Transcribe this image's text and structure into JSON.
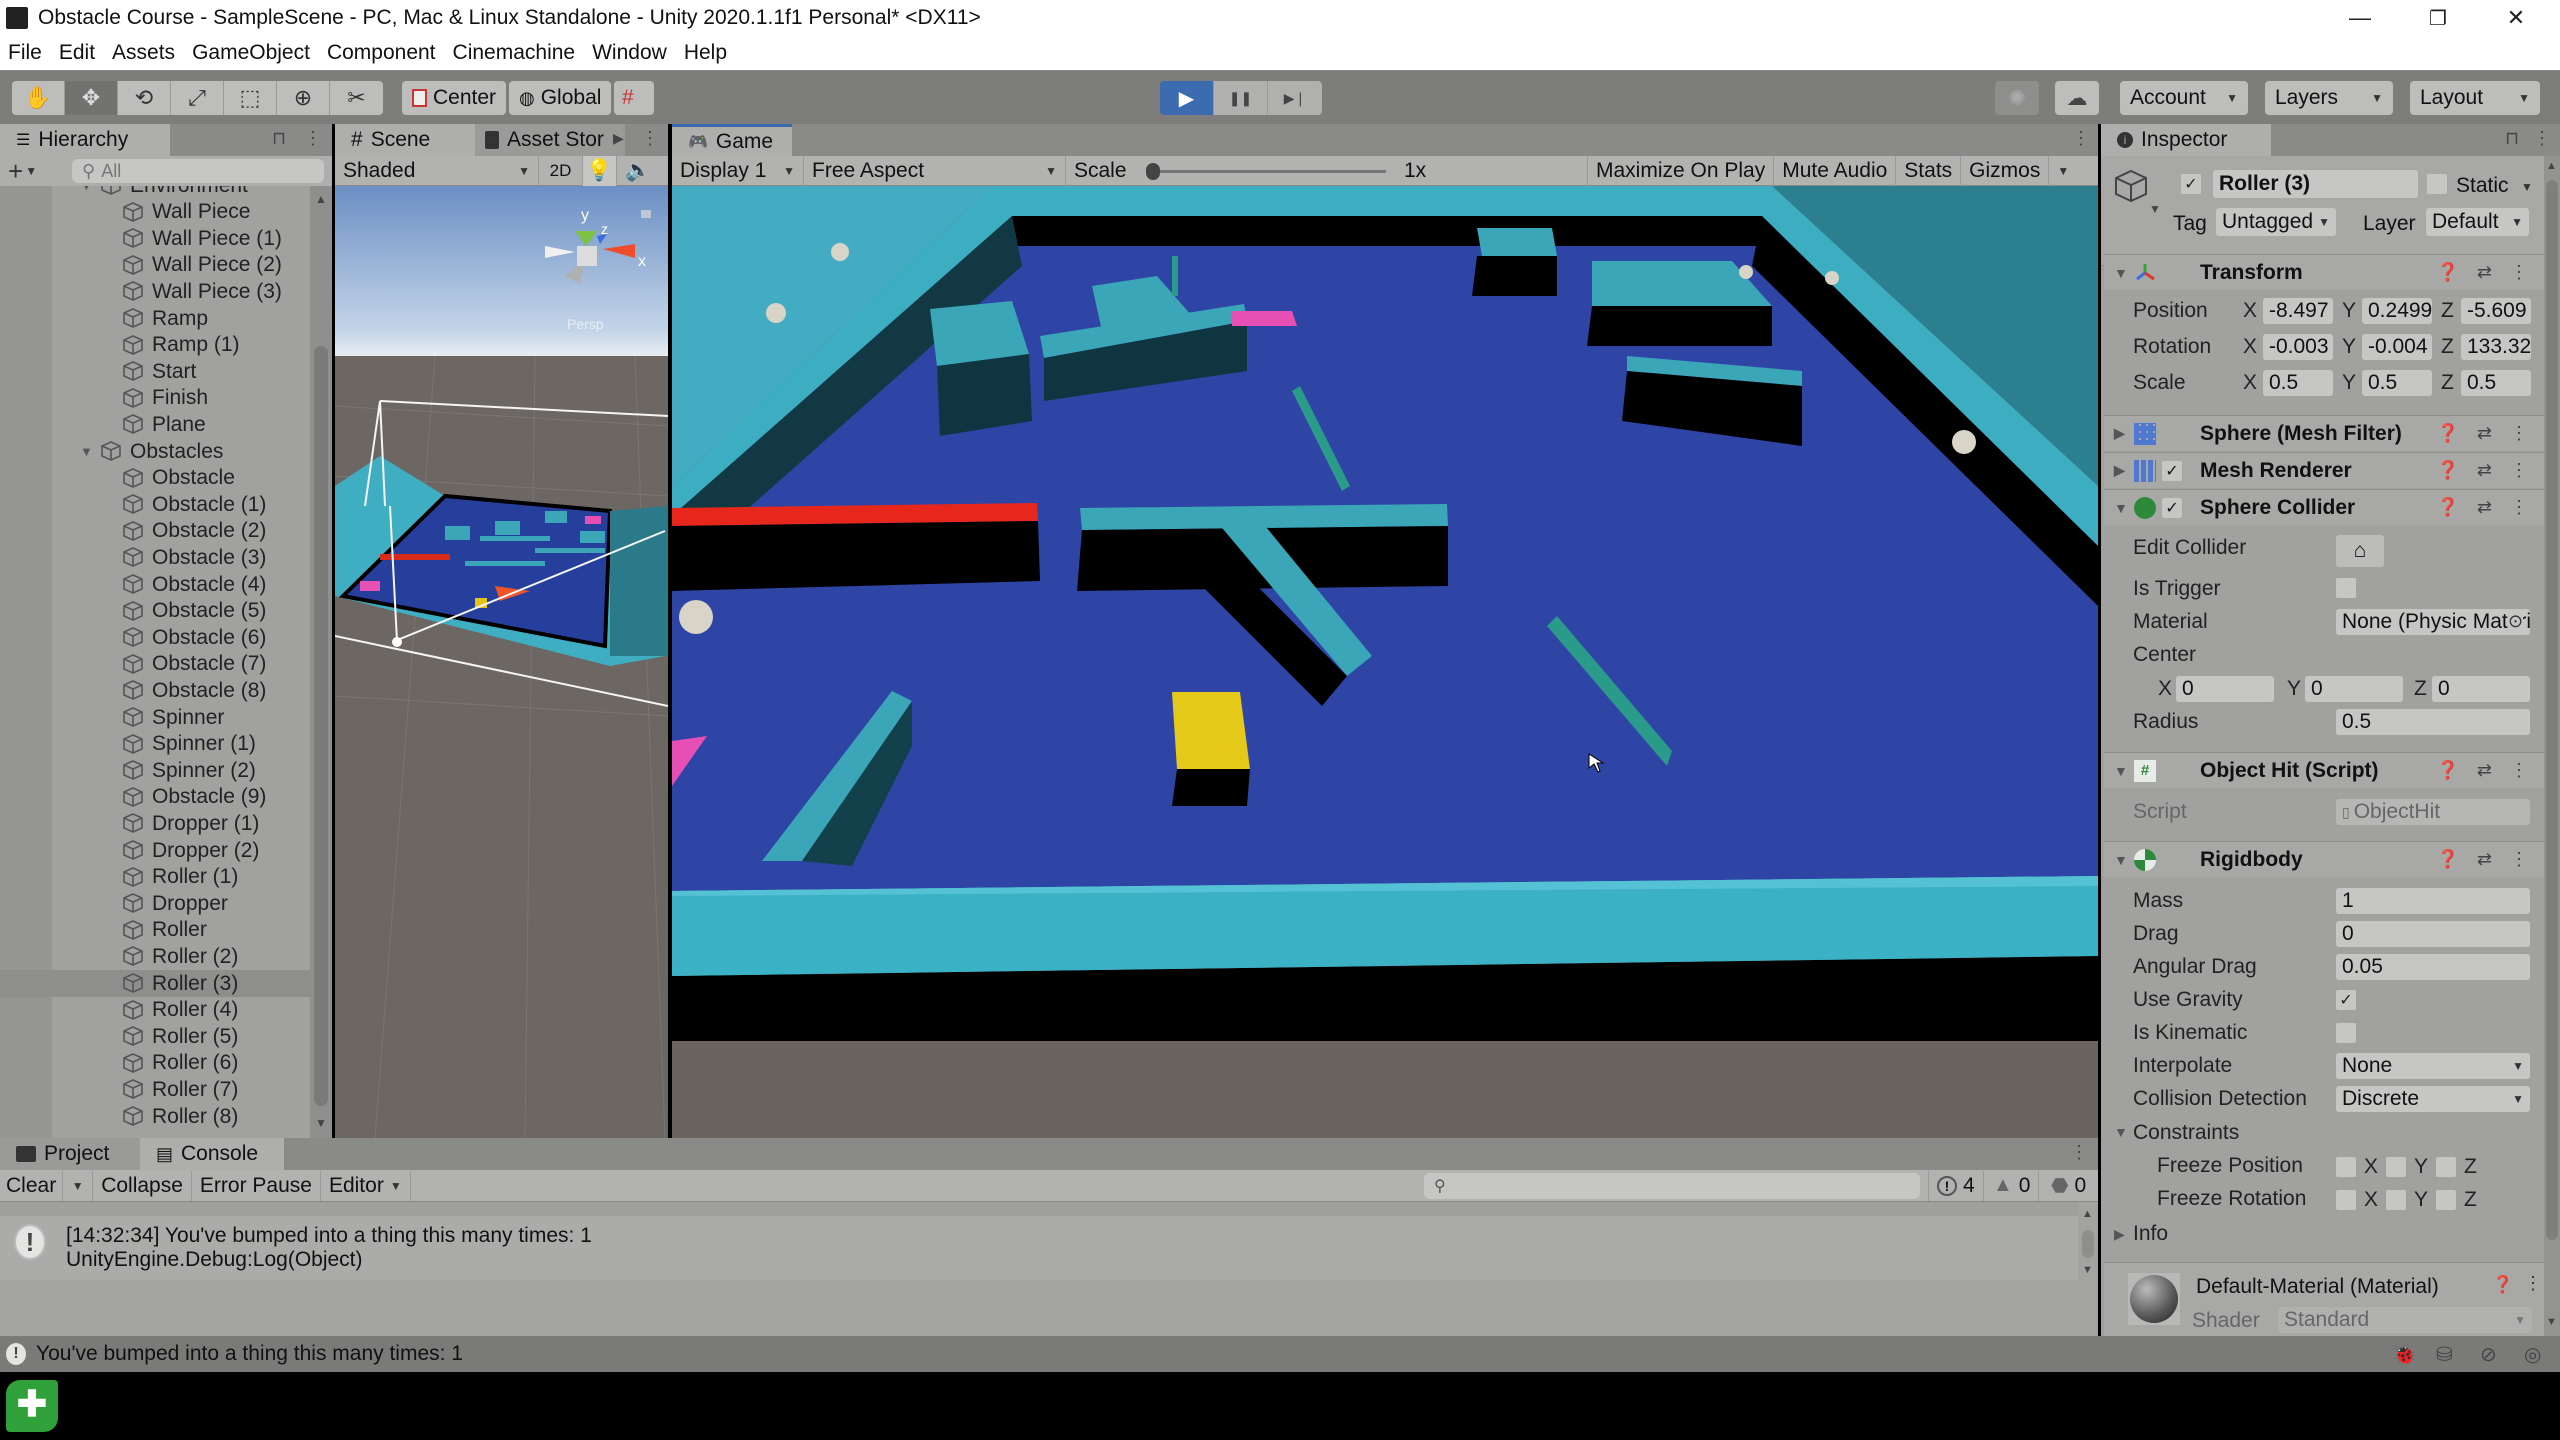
{
  "window": {
    "title": "Obstacle Course - SampleScene - PC, Mac & Linux Standalone - Unity 2020.1.1f1 Personal* <DX11>",
    "minimize": "—",
    "restore": "❐",
    "close": "✕"
  },
  "menu": [
    "File",
    "Edit",
    "Assets",
    "GameObject",
    "Component",
    "Cinemachine",
    "Window",
    "Help"
  ],
  "toolbar": {
    "tools": [
      "hand-tool",
      "move-tool",
      "rotate-tool",
      "scale-tool",
      "rect-tool",
      "transform-tool",
      "custom-tool"
    ],
    "tool_glyphs": [
      "✋",
      "✥",
      "⟲",
      "⤢",
      "⬚",
      "⊕",
      "✂"
    ],
    "pivot_label": "Center",
    "space_label": "Global",
    "play_glyph": "▶",
    "pause_glyph": "❚❚",
    "step_glyph": "▶❘",
    "account_label": "Account",
    "layers_label": "Layers",
    "layout_label": "Layout"
  },
  "hierarchy": {
    "tab_label": "Hierarchy",
    "search_placeholder": "All",
    "items": [
      {
        "label": "Environment",
        "depth": 1,
        "expanded": true
      },
      {
        "label": "Wall Piece",
        "depth": 2
      },
      {
        "label": "Wall Piece (1)",
        "depth": 2
      },
      {
        "label": "Wall Piece (2)",
        "depth": 2
      },
      {
        "label": "Wall Piece (3)",
        "depth": 2
      },
      {
        "label": "Ramp",
        "depth": 2
      },
      {
        "label": "Ramp (1)",
        "depth": 2
      },
      {
        "label": "Start",
        "depth": 2
      },
      {
        "label": "Finish",
        "depth": 2
      },
      {
        "label": "Plane",
        "depth": 2
      },
      {
        "label": "Obstacles",
        "depth": 1,
        "expanded": true
      },
      {
        "label": "Obstacle",
        "depth": 2
      },
      {
        "label": "Obstacle (1)",
        "depth": 2
      },
      {
        "label": "Obstacle (2)",
        "depth": 2
      },
      {
        "label": "Obstacle (3)",
        "depth": 2
      },
      {
        "label": "Obstacle (4)",
        "depth": 2
      },
      {
        "label": "Obstacle (5)",
        "depth": 2
      },
      {
        "label": "Obstacle (6)",
        "depth": 2
      },
      {
        "label": "Obstacle (7)",
        "depth": 2
      },
      {
        "label": "Obstacle (8)",
        "depth": 2
      },
      {
        "label": "Spinner",
        "depth": 2
      },
      {
        "label": "Spinner (1)",
        "depth": 2
      },
      {
        "label": "Spinner (2)",
        "depth": 2
      },
      {
        "label": "Obstacle (9)",
        "depth": 2
      },
      {
        "label": "Dropper (1)",
        "depth": 2
      },
      {
        "label": "Dropper (2)",
        "depth": 2
      },
      {
        "label": "Roller (1)",
        "depth": 2
      },
      {
        "label": "Dropper",
        "depth": 2
      },
      {
        "label": "Roller",
        "depth": 2
      },
      {
        "label": "Roller (2)",
        "depth": 2
      },
      {
        "label": "Roller (3)",
        "depth": 2,
        "selected": true
      },
      {
        "label": "Roller (4)",
        "depth": 2
      },
      {
        "label": "Roller (5)",
        "depth": 2
      },
      {
        "label": "Roller (6)",
        "depth": 2
      },
      {
        "label": "Roller (7)",
        "depth": 2
      },
      {
        "label": "Roller (8)",
        "depth": 2
      }
    ]
  },
  "scene": {
    "tab_label": "Scene",
    "asset_store_tab": "Asset Stor",
    "shading_mode": "Shaded",
    "mode_2d": "2D",
    "gizmo_axes": {
      "x": "x",
      "y": "y",
      "z": "z"
    },
    "projection_label": "Persp"
  },
  "game": {
    "tab_label": "Game",
    "display": "Display 1",
    "aspect": "Free Aspect",
    "scale_label": "Scale",
    "scale_value": "1x",
    "scale_fraction": 0.0,
    "maximize_on_play": "Maximize On Play",
    "mute_audio": "Mute Audio",
    "stats": "Stats",
    "gizmos": "Gizmos"
  },
  "inspector": {
    "tab_label": "Inspector",
    "object_name": "Roller (3)",
    "active": true,
    "static_label": "Static",
    "static": false,
    "tag_label": "Tag",
    "tag": "Untagged",
    "layer_label": "Layer",
    "layer": "Default",
    "transform": {
      "title": "Transform",
      "position": {
        "label": "Position",
        "x": "-8.497",
        "y": "0.2499",
        "z": "-5.609"
      },
      "rotation": {
        "label": "Rotation",
        "x": "-0.003",
        "y": "-0.004",
        "z": "133.32"
      },
      "scale": {
        "label": "Scale",
        "x": "0.5",
        "y": "0.5",
        "z": "0.5"
      }
    },
    "mesh_filter": {
      "title": "Sphere (Mesh Filter)"
    },
    "mesh_renderer": {
      "title": "Mesh Renderer",
      "enabled": true
    },
    "sphere_collider": {
      "title": "Sphere Collider",
      "enabled": true,
      "edit_collider_label": "Edit Collider",
      "is_trigger_label": "Is Trigger",
      "is_trigger": false,
      "material_label": "Material",
      "material": "None (Physic Material)",
      "center_label": "Center",
      "center": {
        "x": "0",
        "y": "0",
        "z": "0"
      },
      "radius_label": "Radius",
      "radius": "0.5"
    },
    "object_hit": {
      "title": "Object Hit (Script)",
      "script_label": "Script",
      "script": "ObjectHit"
    },
    "rigidbody": {
      "title": "Rigidbody",
      "mass_label": "Mass",
      "mass": "1",
      "drag_label": "Drag",
      "drag": "0",
      "angular_drag_label": "Angular Drag",
      "angular_drag": "0.05",
      "use_gravity_label": "Use Gravity",
      "use_gravity": true,
      "is_kinematic_label": "Is Kinematic",
      "is_kinematic": false,
      "interpolate_label": "Interpolate",
      "interpolate": "None",
      "collision_label": "Collision Detection",
      "collision": "Discrete",
      "constraints_label": "Constraints",
      "freeze_position_label": "Freeze Position",
      "freeze_rotation_label": "Freeze Rotation",
      "axis_x": "X",
      "axis_y": "Y",
      "axis_z": "Z",
      "info_label": "Info"
    },
    "material": {
      "title": "Default-Material (Material)",
      "shader_label": "Shader",
      "shader": "Standard"
    }
  },
  "console": {
    "project_tab": "Project",
    "console_tab": "Console",
    "clear": "Clear",
    "collapse": "Collapse",
    "error_pause": "Error Pause",
    "editor": "Editor",
    "search_placeholder": "",
    "log_count": "4",
    "warning_count": "0",
    "error_count": "0",
    "entries": [
      {
        "line1": "[14:32:34] You've bumped into a thing this many times: 1",
        "line2": "UnityEngine.Debug:Log(Object)"
      }
    ]
  },
  "statusbar": {
    "message": "You've bumped into a thing this many times: 1"
  },
  "colors": {
    "accent": "#3d6bb0",
    "panel": "#a1a2a0",
    "toolbar": "#7d7e7c"
  }
}
